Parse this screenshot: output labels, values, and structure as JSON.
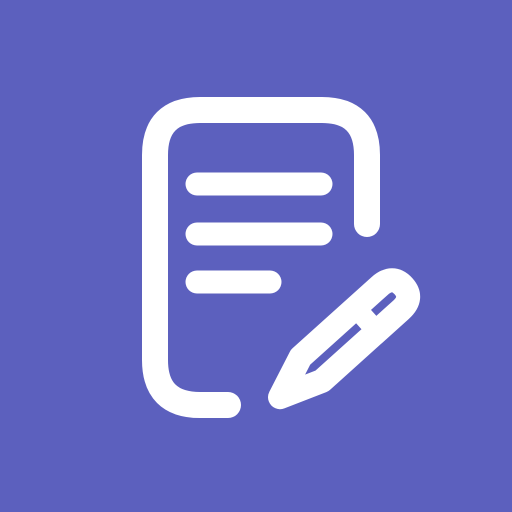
{
  "icon": {
    "name": "notes-edit-icon",
    "background_color": "#5c60be",
    "foreground_color": "#ffffff",
    "glyphs": [
      "document-icon",
      "text-lines",
      "pencil-icon"
    ]
  }
}
